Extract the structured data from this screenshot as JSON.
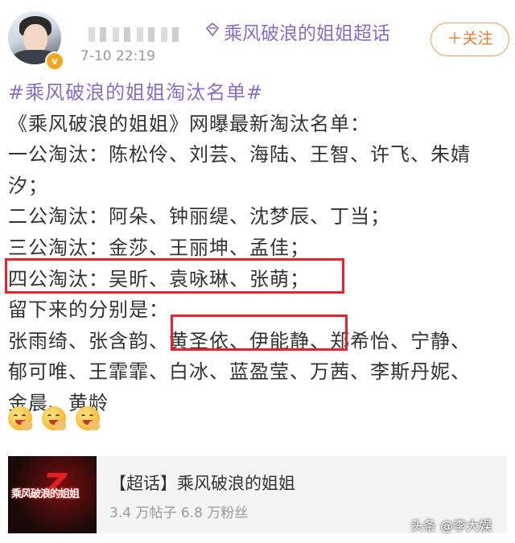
{
  "post": {
    "time": "7-10 22:19",
    "topic": "乘风破浪的姐姐超话",
    "follow_label": "＋关注"
  },
  "content": {
    "hashtag": "#乘风破浪的姐姐淘汰名单#",
    "intro": "《乘风破浪的姐姐》网曝最新淘汰名单：",
    "lines": [
      "一公淘汰：陈松伶、刘芸、海陆、王智、许飞、朱婧",
      "汐；",
      "二公淘汰：阿朵、钟丽缇、沈梦辰、丁当；",
      "三公淘汰：金莎、王丽坤、孟佳；",
      "四公淘汰：吴昕、袁咏琳、张萌；",
      "留下来的分别是：",
      "张雨绮、张含韵、黄圣依、伊能静、郑希怡、宁静、",
      "郁可唯、王霏霏、白冰、蓝盈莹、万茜、李斯丹妮、",
      "金晨、黄龄"
    ]
  },
  "card": {
    "title": "【超话】乘风破浪的姐姐",
    "stats": "3.4 万帖子 6.8 万粉丝",
    "image_text": "乘风破浪的姐姐"
  },
  "watermark": "头条 @李大娱",
  "colors": {
    "hashtag": "#8a6ec0",
    "follow": "#ec7c30",
    "highlight_box": "#e8222e",
    "verified_badge": "#f5a623"
  },
  "icons": {
    "topic": "diamond-icon",
    "verified": "verified-badge-icon",
    "emoji": "drooling-face-emoji"
  }
}
